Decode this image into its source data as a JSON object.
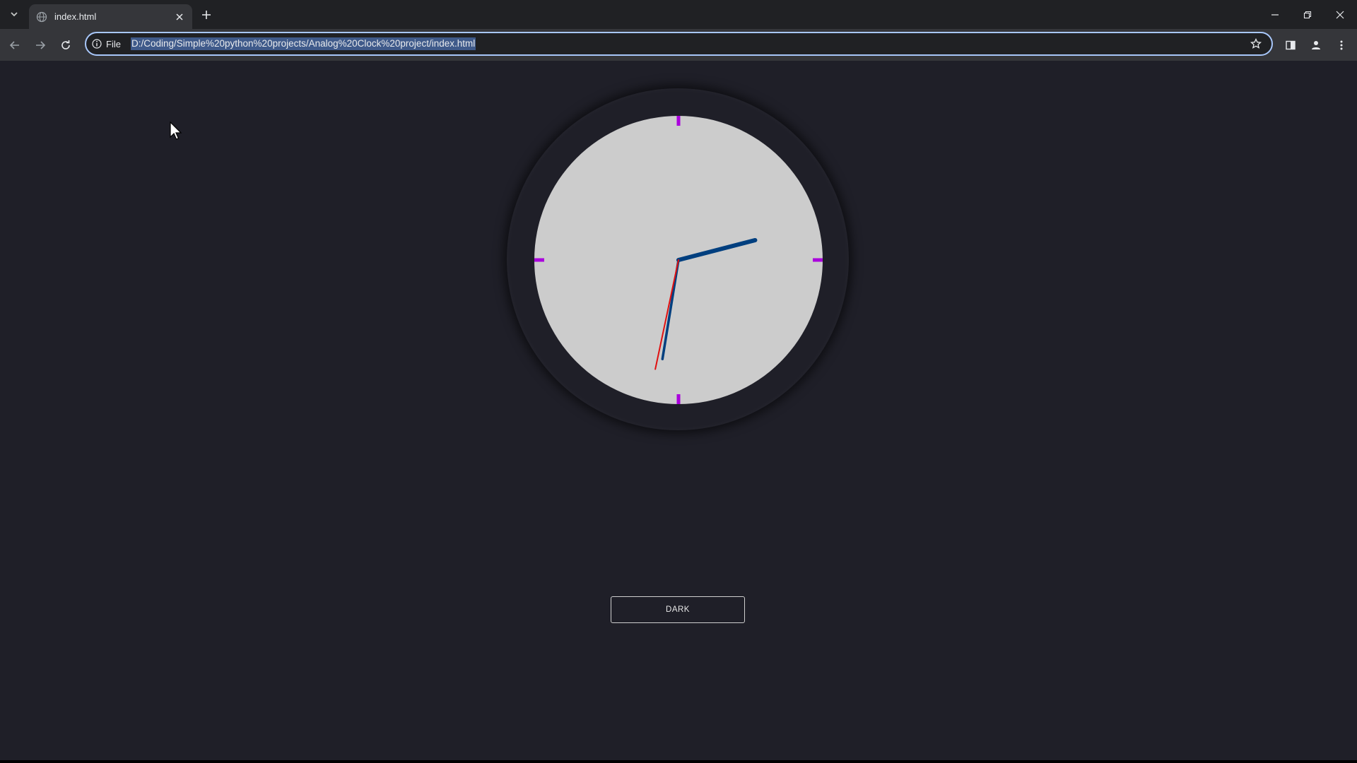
{
  "browser": {
    "tab_title": "index.html",
    "url_chip": "File",
    "url": "D:/Coding/Simple%20python%20projects/Analog%20Clock%20project/index.html"
  },
  "icons": {
    "tab_search": "chevron-down-icon",
    "favicon": "globe-icon",
    "tab_close": "close-icon",
    "new_tab": "plus-icon",
    "back": "arrow-left-icon",
    "forward": "arrow-right-icon",
    "reload": "reload-icon",
    "site_info": "info-icon",
    "bookmark": "star-icon",
    "side_panel": "side-panel-icon",
    "profile": "person-icon",
    "menu": "kebab-menu-icon",
    "minimize": "minimize-icon",
    "restore": "restore-icon",
    "close_window": "close-icon"
  },
  "clock": {
    "hour": 2,
    "minute": 31,
    "second": 32,
    "face_color": "#cccccc",
    "marker_color": "#aa00dd",
    "hour_hand_color": "#003f7f",
    "minute_hand_color": "#003f7f",
    "second_hand_color": "#e01010"
  },
  "mode_button": {
    "label": "DARK"
  },
  "colors": {
    "page_background": "#1f1f28",
    "omnibox_focus": "#a8c7fa",
    "url_selection": "#3f5a8a"
  }
}
